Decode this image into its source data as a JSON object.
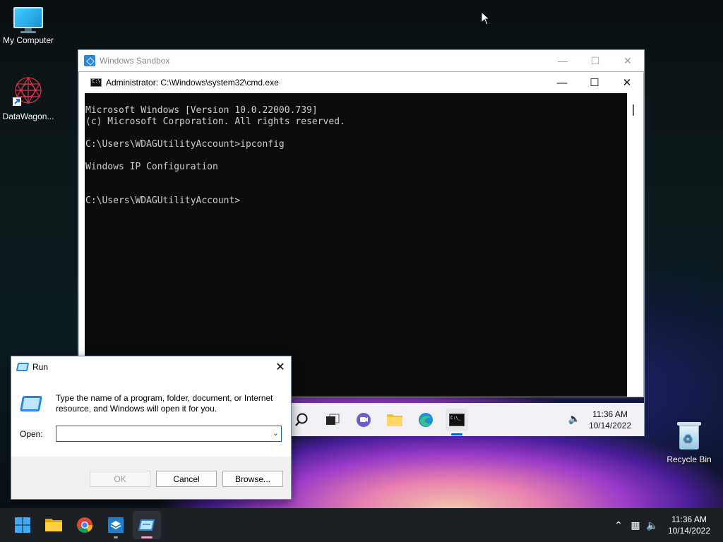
{
  "desktop": {
    "icons": [
      {
        "label": "My Computer"
      },
      {
        "label": "DataWagon..."
      }
    ],
    "recycle_bin": "Recycle Bin"
  },
  "sandbox": {
    "title": "Windows Sandbox",
    "cmd": {
      "title": "Administrator: C:\\Windows\\system32\\cmd.exe",
      "lines": [
        "Microsoft Windows [Version 10.0.22000.739]",
        "(c) Microsoft Corporation. All rights reserved.",
        "",
        "C:\\Users\\WDAGUtilityAccount>ipconfig",
        "",
        "Windows IP Configuration",
        "",
        "",
        "C:\\Users\\WDAGUtilityAccount>"
      ]
    },
    "taskbar": {
      "icons": [
        "search-icon",
        "task-view-icon",
        "teams-chat-icon",
        "file-explorer-icon",
        "edge-icon",
        "cmd-icon"
      ],
      "time": "11:36 AM",
      "date": "10/14/2022"
    }
  },
  "run_dialog": {
    "title": "Run",
    "description": "Type the name of a program, folder, document, or Internet resource, and Windows will open it for you.",
    "open_label": "Open:",
    "open_value": "",
    "buttons": {
      "ok": "OK",
      "cancel": "Cancel",
      "browse": "Browse..."
    }
  },
  "taskbar": {
    "icons": [
      "start-icon",
      "file-explorer-icon",
      "chrome-icon",
      "sandbox-app-icon",
      "run-app-icon"
    ],
    "time": "11:36 AM",
    "date": "10/14/2022"
  }
}
